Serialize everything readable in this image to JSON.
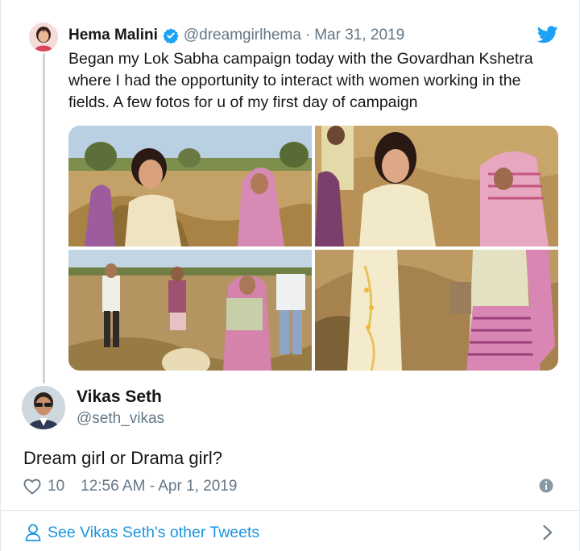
{
  "quoted_tweet": {
    "author_name": "Hema Malini",
    "handle": "@dreamgirlhema",
    "separator": "·",
    "date": "Mar 31, 2019",
    "text": "Began my Lok Sabha campaign today with the Govardhan Kshetra where I had the opportunity to interact with women working in the fields. A few fotos  for u of my first day of campaign",
    "verified": true,
    "photos": [
      "photo-1",
      "photo-2",
      "photo-3",
      "photo-4"
    ]
  },
  "reply": {
    "author_name": "Vikas Seth",
    "handle": "@seth_vikas",
    "text": "Dream girl or Drama girl?",
    "likes": "10",
    "timestamp": "12:56 AM - Apr 1, 2019"
  },
  "footer": {
    "link_label": "See Vikas Seth's other Tweets"
  },
  "icons": {
    "verified": "verified-badge-icon",
    "brand": "twitter-bird-icon",
    "like": "heart-icon",
    "info": "info-icon",
    "user": "person-icon",
    "next": "chevron-right-icon"
  },
  "colors": {
    "accent": "#1da1f2",
    "link": "#1b95e0",
    "secondary_text": "#657786",
    "primary_text": "#14171a",
    "border": "#e1e8ed"
  }
}
